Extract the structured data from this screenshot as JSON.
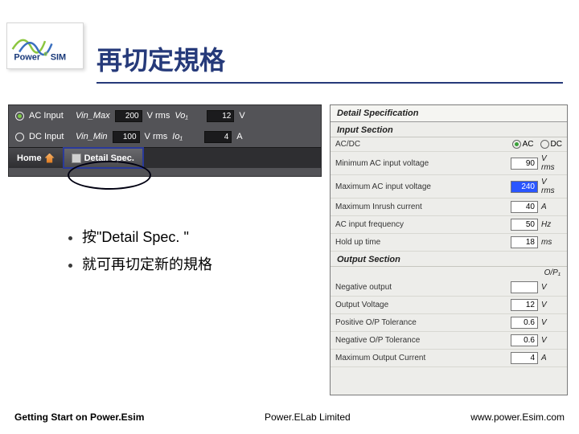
{
  "logo_text": {
    "power": "Power",
    "e": "e",
    "sim": "SIM"
  },
  "title": "再切定規格",
  "panel_left": {
    "rows": [
      {
        "radio": true,
        "label": "AC Input",
        "sym": "Vin_Max",
        "value": "200",
        "unit": "V rms",
        "sym2": "Vo₁",
        "value2": "12",
        "unit2": "V"
      },
      {
        "radio": false,
        "label": "DC Input",
        "sym": "Vin_Min",
        "value": "100",
        "unit": "V rms",
        "sym2": "Io₁",
        "value2": "4",
        "unit2": "A"
      }
    ],
    "tabs": {
      "home": "Home",
      "detail": "Detail Spec."
    }
  },
  "bullets": [
    "按\"Detail Spec. \"",
    "就可再切定新的規格"
  ],
  "panel_right": {
    "title": "Detail Specification",
    "input_section": "Input Section",
    "acdc": {
      "label": "AC/DC",
      "ac": "AC",
      "dc": "DC",
      "selected": "ac"
    },
    "rows_in": [
      {
        "label": "Minimum AC input voltage",
        "value": "90",
        "unit": "V rms",
        "hl": false
      },
      {
        "label": "Maximum AC input voltage",
        "value": "240",
        "unit": "V rms",
        "hl": true
      },
      {
        "label": "Maximum Inrush current",
        "value": "40",
        "unit": "A",
        "hl": false
      },
      {
        "label": "AC input frequency",
        "value": "50",
        "unit": "Hz",
        "hl": false
      },
      {
        "label": "Hold up time",
        "value": "18",
        "unit": "ms",
        "hl": false
      }
    ],
    "output_section": "Output Section",
    "output_sub": "O/P₁",
    "rows_out": [
      {
        "label": "Negative output",
        "value": "",
        "unit": "V"
      },
      {
        "label": "Output Voltage",
        "value": "12",
        "unit": "V"
      },
      {
        "label": "Positive O/P Tolerance",
        "value": "0.6",
        "unit": "V"
      },
      {
        "label": "Negative O/P Tolerance",
        "value": "0.6",
        "unit": "V"
      },
      {
        "label": "Maximum Output Current",
        "value": "4",
        "unit": "A"
      }
    ]
  },
  "footer": {
    "left": "Getting Start on Power.Esim",
    "center": "Power.ELab Limited",
    "right": "www.power.Esim.com"
  }
}
